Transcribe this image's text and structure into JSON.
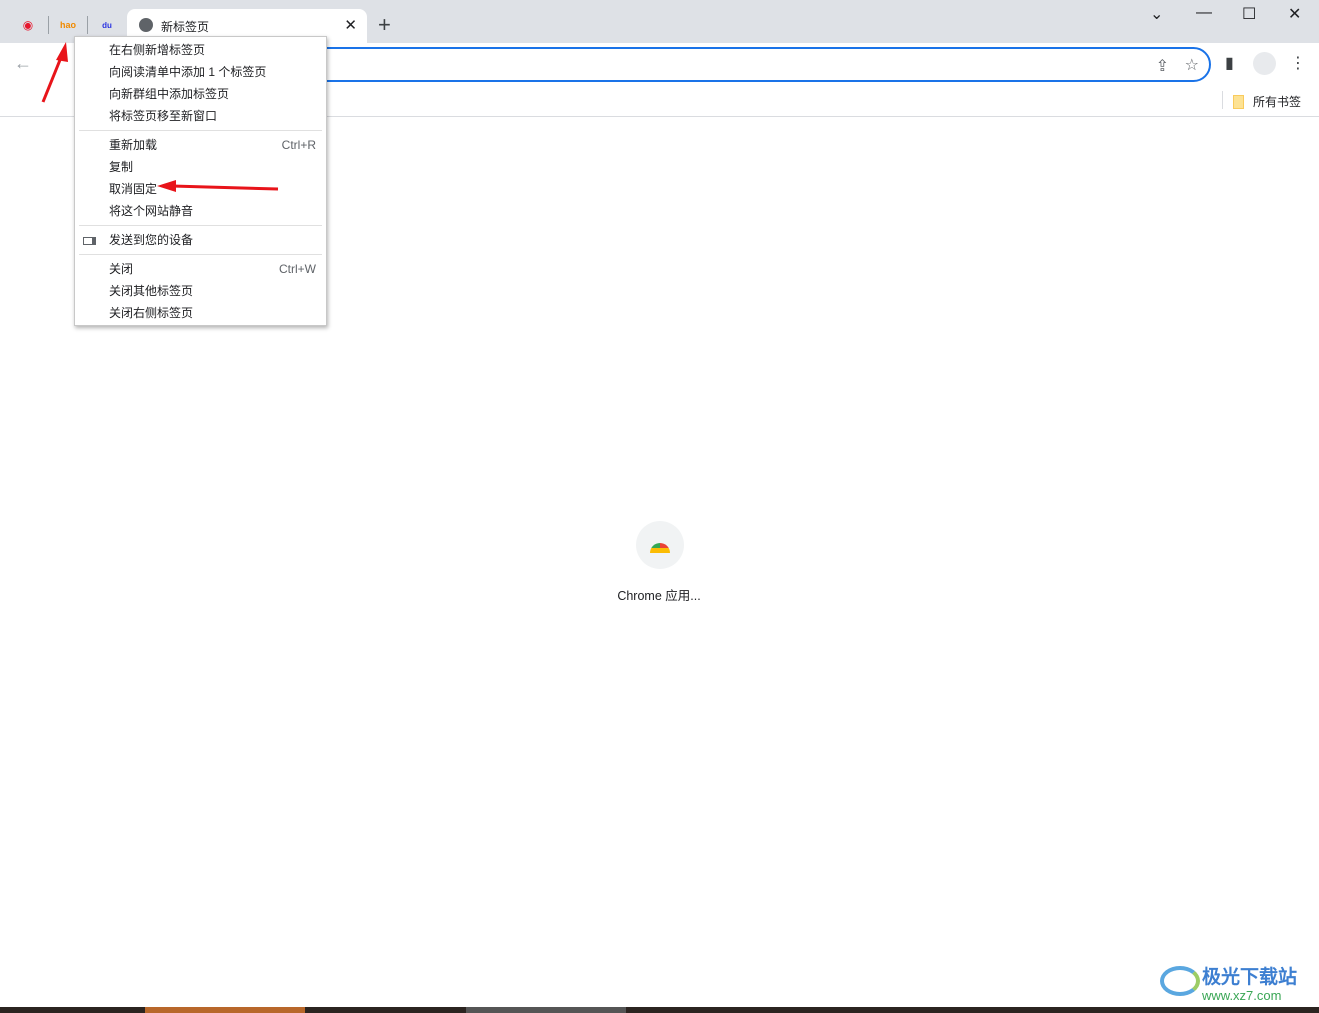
{
  "tabstrip": {
    "pinned_tabs": [
      {
        "icon": "weibo-icon"
      },
      {
        "icon": "hao123-icon",
        "label": "hao"
      },
      {
        "icon": "baidu-icon",
        "label": "du"
      }
    ],
    "active_tab": {
      "title": "新标签页",
      "icon": "globe-icon"
    },
    "new_tab": "+",
    "window_controls": {
      "tab_search": "⌄",
      "minimize": "—",
      "maximize": "☐",
      "close": "✕"
    }
  },
  "toolbar": {
    "back": "←",
    "share": "⇪",
    "star": "☆",
    "side_panel": "▮",
    "menu": "⋮"
  },
  "bookmarks": {
    "all_bookmarks": "所有书签"
  },
  "context_menu": {
    "groups": [
      [
        {
          "label": "在右侧新增标签页"
        },
        {
          "label": "向阅读清单中添加 1 个标签页"
        },
        {
          "label": "向新群组中添加标签页"
        },
        {
          "label": "将标签页移至新窗口"
        }
      ],
      [
        {
          "label": "重新加载",
          "shortcut": "Ctrl+R"
        },
        {
          "label": "复制"
        },
        {
          "label": "取消固定"
        },
        {
          "label": "将这个网站静音"
        }
      ],
      [
        {
          "label": "发送到您的设备",
          "icon": "devices-icon"
        }
      ],
      [
        {
          "label": "关闭",
          "shortcut": "Ctrl+W"
        },
        {
          "label": "关闭其他标签页"
        },
        {
          "label": "关闭右侧标签页"
        }
      ]
    ]
  },
  "content": {
    "app_label": "Chrome 应用..."
  },
  "watermark": {
    "name": "极光下载站",
    "url": "www.xz7.com"
  },
  "colors": {
    "accent": "#1a73e8",
    "annotation_arrow": "#e8141a"
  }
}
